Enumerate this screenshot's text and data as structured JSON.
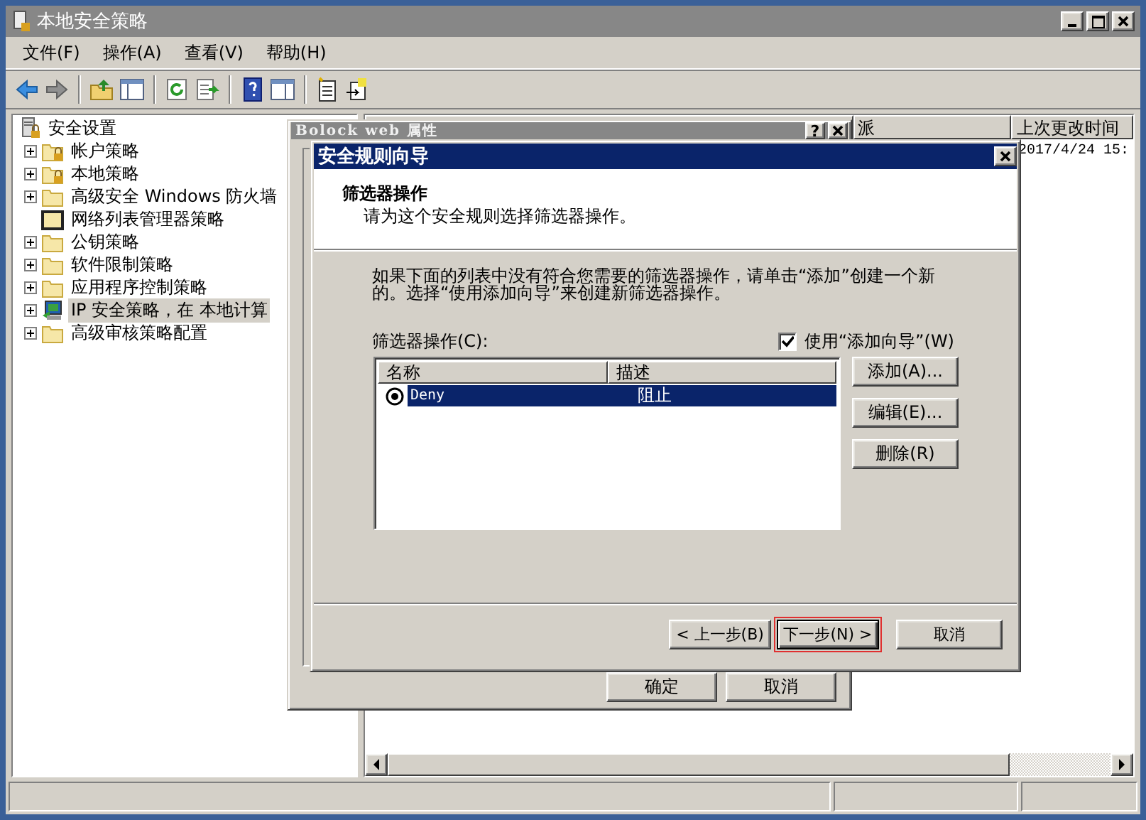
{
  "main_window": {
    "title": "本地安全策略",
    "menu": [
      "文件(F)",
      "操作(A)",
      "查看(V)",
      "帮助(H)"
    ]
  },
  "tree": {
    "label": "安全设置",
    "kind": "lock-server",
    "children": [
      {
        "label": "帐户策略",
        "kind": "lock-folder",
        "expandable": true,
        "selected": false
      },
      {
        "label": "本地策略",
        "kind": "lock-folder",
        "expandable": true,
        "selected": false
      },
      {
        "label": "高级安全 Windows 防火墙",
        "kind": "folder",
        "expandable": true,
        "selected": false
      },
      {
        "label": "网络列表管理器策略",
        "kind": "dark-folder",
        "expandable": false,
        "selected": false
      },
      {
        "label": "公钥策略",
        "kind": "folder",
        "expandable": true,
        "selected": false
      },
      {
        "label": "软件限制策略",
        "kind": "folder",
        "expandable": true,
        "selected": false
      },
      {
        "label": "应用程序控制策略",
        "kind": "folder",
        "expandable": true,
        "selected": false
      },
      {
        "label": "IP 安全策略，在 本地计算",
        "kind": "shield-computer",
        "expandable": true,
        "selected": true
      },
      {
        "label": "高级审核策略配置",
        "kind": "folder",
        "expandable": true,
        "selected": false
      }
    ]
  },
  "list": {
    "columns": [
      "派",
      "上次更改时间"
    ],
    "rows": [
      {
        "last_changed": "2017/4/24 15:"
      }
    ]
  },
  "properties_dialog": {
    "title": "Bolock web 属性",
    "help_button": "?",
    "buttons": [
      "确定",
      "取消"
    ]
  },
  "wizard": {
    "title": "安全规则向导",
    "heading": "筛选器操作",
    "subheading": "请为这个安全规则选择筛选器操作。",
    "description": "如果下面的列表中没有符合您需要的筛选器操作，请单击“添加”创建一个新的。选择“使用添加向导”来创建新筛选器操作。",
    "list_label": "筛选器操作(C):",
    "use_wizard": {
      "label": "使用“添加向导”(W)",
      "checked": true
    },
    "columns": [
      "名称",
      "描述"
    ],
    "rows": [
      {
        "name": "Deny",
        "description": "阻止",
        "selected": true
      }
    ],
    "side_buttons": [
      "添加(A)...",
      "编辑(E)...",
      "删除(R)"
    ],
    "nav_buttons": [
      {
        "label": "< 上一步(B)",
        "highlighted": false
      },
      {
        "label": "下一步(N) >",
        "highlighted": true
      },
      {
        "label": "取消",
        "highlighted": false
      }
    ]
  }
}
